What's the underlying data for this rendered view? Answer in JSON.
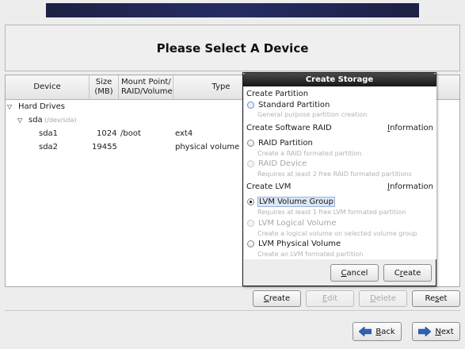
{
  "page": {
    "title": "Please Select A Device"
  },
  "table": {
    "headers": {
      "device": "Device",
      "size_line1": "Size",
      "size_line2": "(MB)",
      "mount_line1": "Mount Point/",
      "mount_line2": "RAID/Volume",
      "type": "Type"
    },
    "group_label": "Hard Drives",
    "disk": {
      "name": "sda",
      "path": "(/dev/sda)"
    },
    "partitions": [
      {
        "device": "sda1",
        "size": "1024",
        "mount": "/boot",
        "type": "ext4"
      },
      {
        "device": "sda2",
        "size": "19455",
        "mount": "",
        "type": "physical volume ("
      }
    ]
  },
  "actions": {
    "create": {
      "pre": "",
      "mn": "C",
      "post": "reate"
    },
    "edit": {
      "pre": "",
      "mn": "E",
      "post": "dit"
    },
    "delete": {
      "pre": "",
      "mn": "D",
      "post": "elete"
    },
    "reset": {
      "pre": "Re",
      "mn": "s",
      "post": "et"
    }
  },
  "nav": {
    "back": {
      "pre": "",
      "mn": "B",
      "post": "ack"
    },
    "next": {
      "pre": "",
      "mn": "N",
      "post": "ext"
    }
  },
  "dialog": {
    "title": "Create Storage",
    "sections": {
      "partition": "Create Partition",
      "raid": "Create Software RAID",
      "lvm": "Create LVM"
    },
    "info": {
      "pre": "",
      "mn": "I",
      "post": "nformation"
    },
    "options": {
      "standard": {
        "label": "Standard Partition",
        "desc": "General purpose partition creation"
      },
      "raid_partition": {
        "label": "RAID Partition",
        "desc": "Create a RAID formated partition"
      },
      "raid_device": {
        "label": "RAID Device",
        "desc": "Requires at least 2 free RAID formated partitions"
      },
      "lvm_vg": {
        "label": "LVM Volume Group",
        "desc": "Requires at least 1 free LVM formated partition"
      },
      "lvm_lv": {
        "label": "LVM Logical Volume",
        "desc": "Create a logical volume on selected volume group"
      },
      "lvm_pv": {
        "label": "LVM Physical Volume",
        "desc": "Create an LVM formated partition"
      }
    },
    "buttons": {
      "cancel": {
        "pre": "",
        "mn": "C",
        "post": "ancel"
      },
      "create": {
        "pre": "C",
        "mn": "r",
        "post": "eate"
      }
    },
    "selected_option": "lvm_vg"
  },
  "colors": {
    "banner": "#262c63",
    "dialog_title": "#161616",
    "selection": "#dbe7f5",
    "next_arrow": "#2e62b6",
    "back_arrow": "#2e62b6"
  },
  "icons": {
    "expand": "triangle-down-icon",
    "back": "arrow-left-icon",
    "next": "arrow-right-icon"
  }
}
